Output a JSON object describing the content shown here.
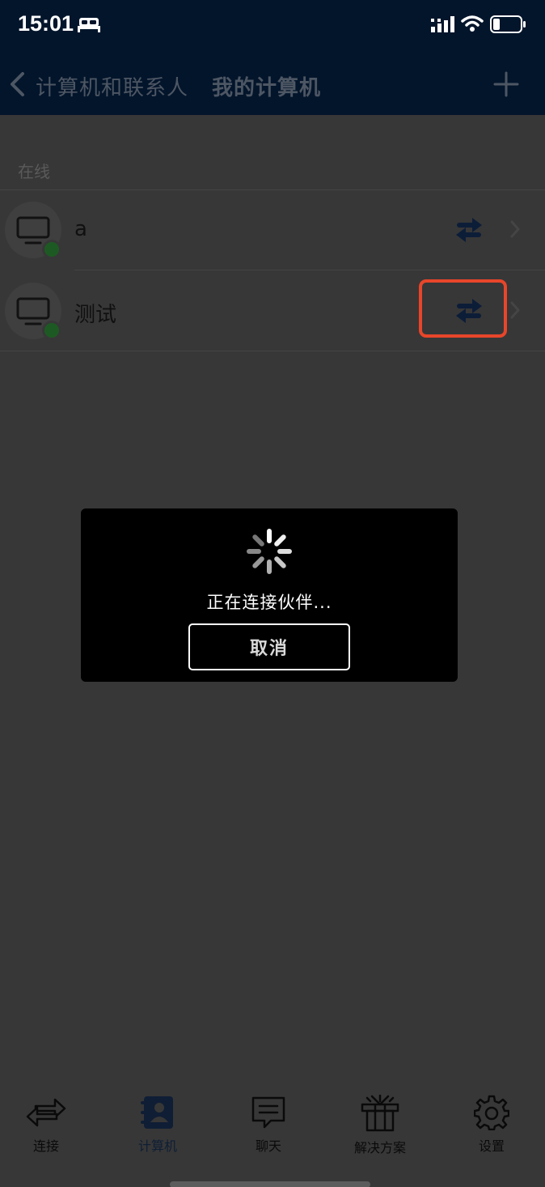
{
  "status_bar": {
    "time": "15:01"
  },
  "nav": {
    "back_label": "计算机和联系人",
    "title": "我的计算机"
  },
  "section": {
    "header": "在线"
  },
  "computers": [
    {
      "name": "a"
    },
    {
      "name": "测试"
    }
  ],
  "dialog": {
    "message": "正在连接伙伴...",
    "cancel_label": "取消"
  },
  "tab_bar": {
    "tabs": [
      {
        "label": "连接",
        "icon": "connect-arrows-icon"
      },
      {
        "label": "计算机",
        "icon": "contacts-book-icon",
        "active": true
      },
      {
        "label": "聊天",
        "icon": "chat-bubble-icon"
      },
      {
        "label": "解决方案",
        "icon": "gift-box-icon"
      },
      {
        "label": "设置",
        "icon": "gear-icon"
      }
    ]
  },
  "colors": {
    "nav_background": "#03152b",
    "overlay_background": "#373737",
    "highlight": "#e8452a",
    "online": "#1d5a23",
    "accent": "#0f1e35"
  }
}
